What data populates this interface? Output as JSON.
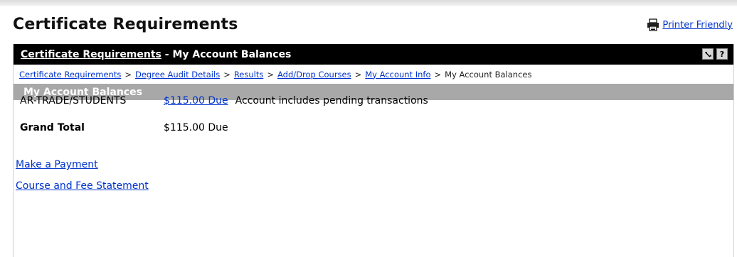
{
  "page": {
    "title": "Certificate Requirements",
    "printer_friendly": "Printer Friendly"
  },
  "panel": {
    "header_link": "Certificate Requirements",
    "header_separator": " - ",
    "header_current": "My Account Balances",
    "tools": {
      "settings_icon": "link-tool-icon",
      "help_label": "?"
    }
  },
  "breadcrumb": {
    "items": [
      {
        "label": "Certificate Requirements",
        "link": true
      },
      {
        "label": "Degree Audit Details",
        "link": true
      },
      {
        "label": "Results",
        "link": true
      },
      {
        "label": "Add/Drop Courses",
        "link": true
      },
      {
        "label": "My Account Info",
        "link": true
      },
      {
        "label": "My Account Balances",
        "link": false
      }
    ],
    "separator": ">"
  },
  "section": {
    "title": "My Account Balances"
  },
  "balances": {
    "account": {
      "label": "AR-TRADE/STUDENTS",
      "amount": "$115.00 Due",
      "note": "Account includes pending transactions"
    },
    "total": {
      "label": "Grand Total",
      "amount": "$115.00 Due"
    }
  },
  "links": {
    "make_payment": "Make a Payment",
    "course_fee_statement": "Course and Fee Statement"
  },
  "colors": {
    "link": "#0033cc",
    "header_bg": "#000000",
    "section_bg": "#a8a8a8"
  }
}
